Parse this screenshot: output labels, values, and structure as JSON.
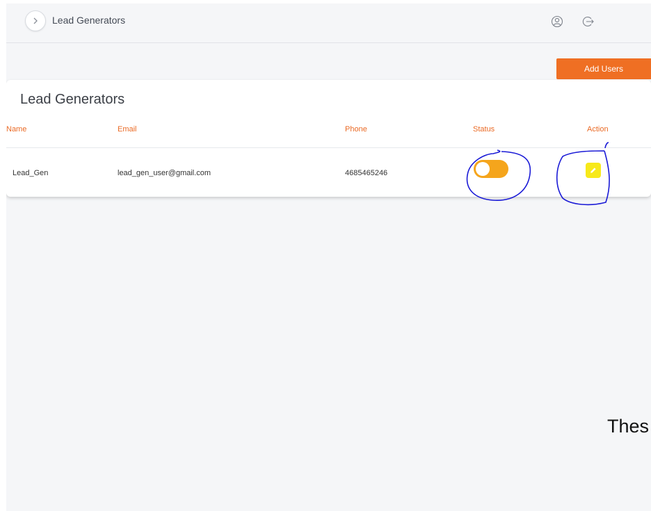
{
  "header": {
    "title": "Lead Generators",
    "icons": [
      "chevron-right-icon",
      "user-circle-icon",
      "logout-icon"
    ]
  },
  "toolbar": {
    "add_users_label": "Add Users"
  },
  "card": {
    "title": "Lead Generators",
    "columns": [
      "Name",
      "Email",
      "Phone",
      "Status",
      "Action"
    ],
    "rows": [
      {
        "name": "Lead_Gen",
        "email": "lead_gen_user@gmail.com",
        "phone": "4685465246",
        "status_on": true,
        "action_icon": "pencil-icon"
      }
    ]
  },
  "overlay_text": "Thes",
  "colors": {
    "accent_orange": "#ef6f23",
    "header_text": "#ea6a25",
    "toggle_on": "#f5a51c",
    "edit_button": "#f7e91a",
    "annotation_ink": "#1a1ad6",
    "background": "#f5f6f8"
  }
}
